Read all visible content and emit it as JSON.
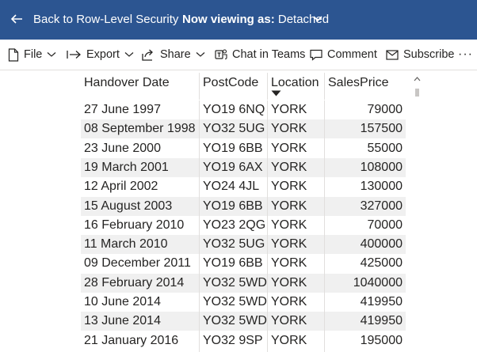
{
  "topbar": {
    "back_label": "Back to Row-Level Security",
    "viewing_prefix": "Now viewing as:",
    "viewing_value": "Detached"
  },
  "toolbar": {
    "file": "File",
    "export": "Export",
    "share": "Share",
    "chat": "Chat in Teams",
    "comment": "Comment",
    "subscribe": "Subscribe",
    "more": "···"
  },
  "table": {
    "columns": [
      "Handover Date",
      "PostCode",
      "Location",
      "SalesPrice"
    ],
    "sorted_column": "Location",
    "rows": [
      [
        "27 June 1997",
        "YO19 6NQ",
        "YORK",
        "79000"
      ],
      [
        "08 September 1998",
        "YO32 5UG",
        "YORK",
        "157500"
      ],
      [
        "23 June 2000",
        "YO19 6BB",
        "YORK",
        "55000"
      ],
      [
        "19 March 2001",
        "YO19 6AX",
        "YORK",
        "108000"
      ],
      [
        "12 April 2002",
        "YO24 4JL",
        "YORK",
        "130000"
      ],
      [
        "15 August 2003",
        "YO19 6BB",
        "YORK",
        "327000"
      ],
      [
        "16 February 2010",
        "YO23 2QG",
        "YORK",
        "70000"
      ],
      [
        "11 March 2010",
        "YO32 5UG",
        "YORK",
        "400000"
      ],
      [
        "09 December 2011",
        "YO19 6BB",
        "YORK",
        "425000"
      ],
      [
        "28 February 2014",
        "YO32 5WD",
        "YORK",
        "1040000"
      ],
      [
        "10 June 2014",
        "YO32 5WD",
        "YORK",
        "419950"
      ],
      [
        "13 June 2014",
        "YO32 5WD",
        "YORK",
        "419950"
      ],
      [
        "21 January 2016",
        "YO32 9SP",
        "YORK",
        "195000"
      ]
    ]
  },
  "colors": {
    "topbar": "#2c5591",
    "row_shade": "#f0f0f0",
    "text": "#252423"
  },
  "icons": [
    "back-arrow-icon",
    "chevron-down-icon",
    "file-icon",
    "export-arrow-icon",
    "share-icon",
    "teams-icon",
    "comment-icon",
    "mail-icon",
    "more-icon",
    "sort-descending-icon",
    "scroll-up-icon"
  ]
}
